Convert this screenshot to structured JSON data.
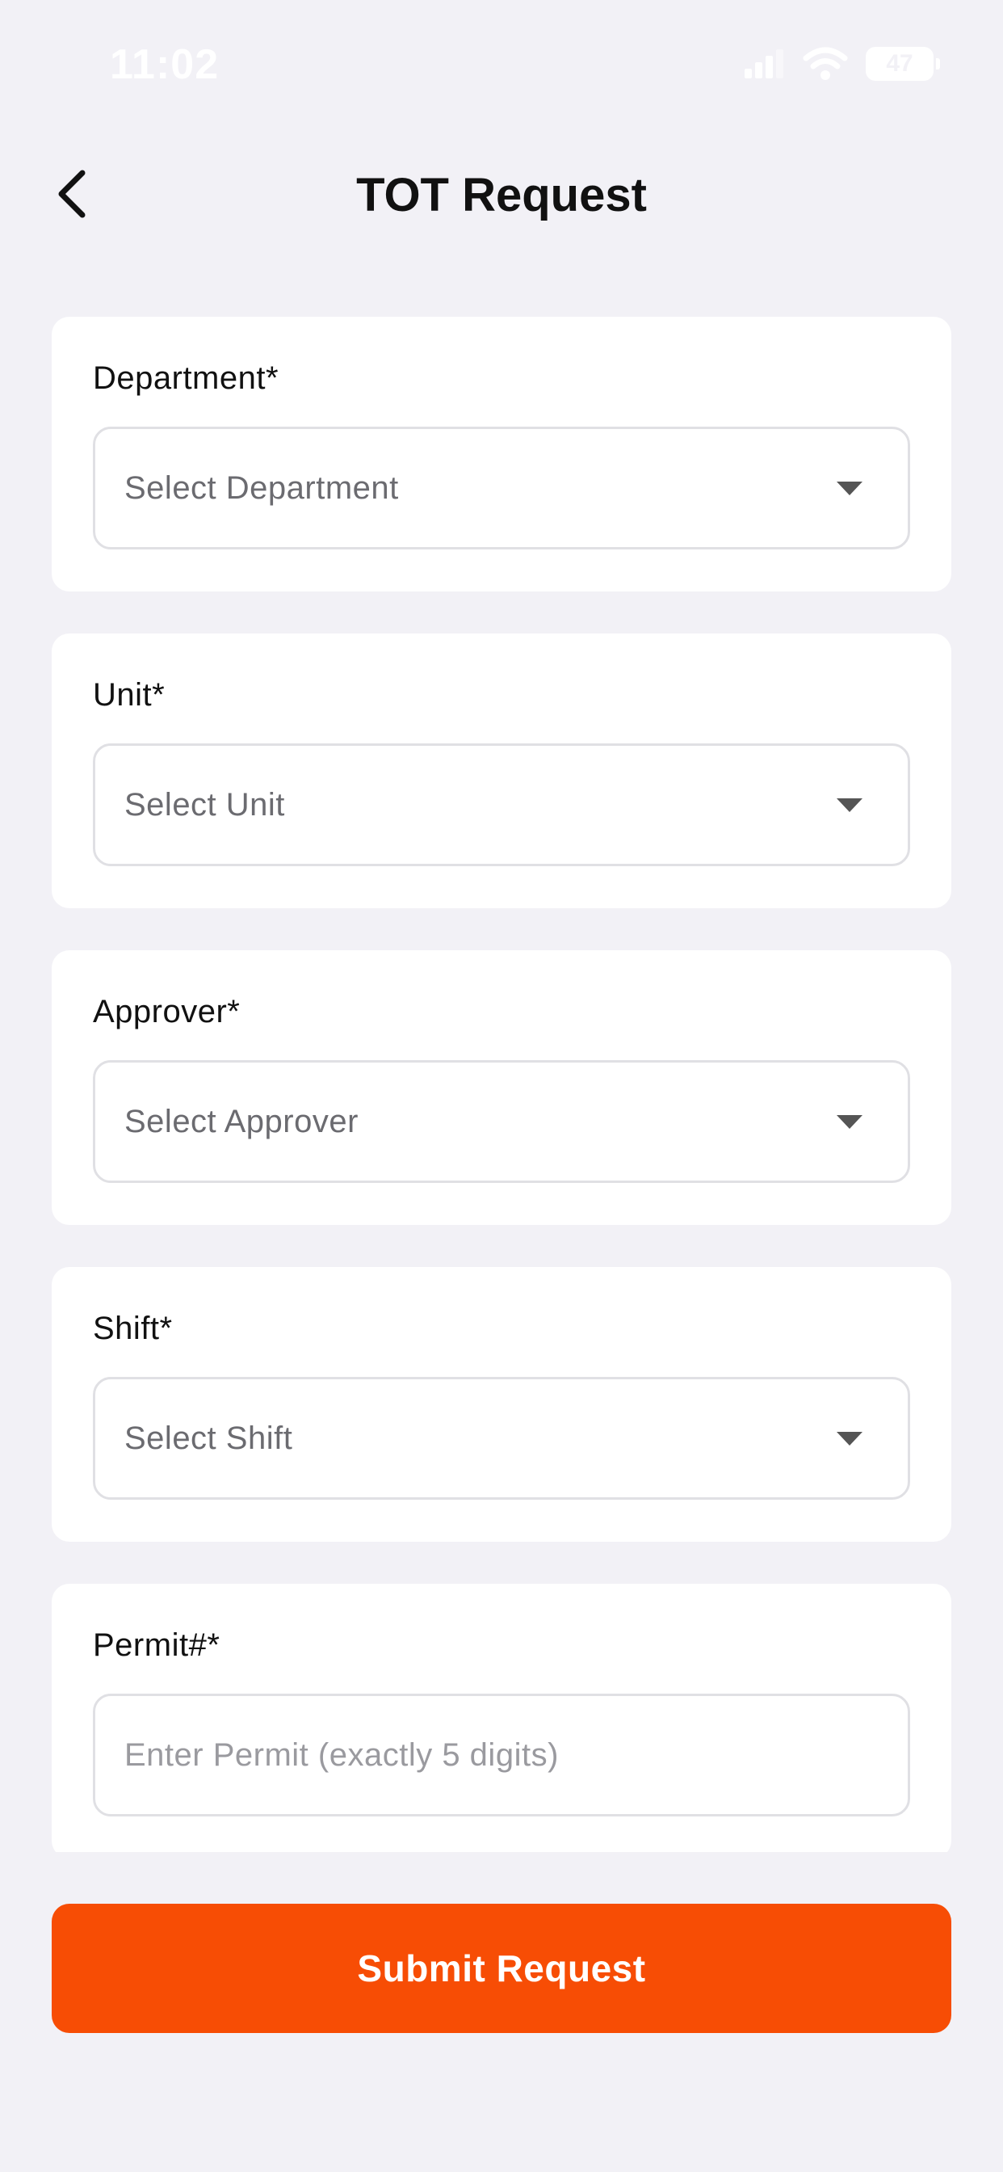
{
  "status_bar": {
    "time": "11:02",
    "battery_level": "47",
    "icons": [
      "signal-icon",
      "wifi-icon",
      "battery-icon"
    ]
  },
  "header": {
    "title": "TOT Request",
    "back_icon": "chevron-left-icon"
  },
  "form": {
    "department": {
      "label": "Department*",
      "value": "Select Department"
    },
    "unit": {
      "label": "Unit*",
      "value": "Select Unit"
    },
    "approver": {
      "label": "Approver*",
      "value": "Select Approver"
    },
    "shift": {
      "label": "Shift*",
      "value": "Select Shift"
    },
    "permit": {
      "label": "Permit#*",
      "value": "",
      "placeholder": "Enter Permit (exactly 5 digits)"
    }
  },
  "actions": {
    "submit_label": "Submit Request"
  },
  "colors": {
    "background": "#f2f1f6",
    "card": "#ffffff",
    "accent": "#f74d05",
    "input_border": "#e0e0e4",
    "title_text": "#111111"
  }
}
